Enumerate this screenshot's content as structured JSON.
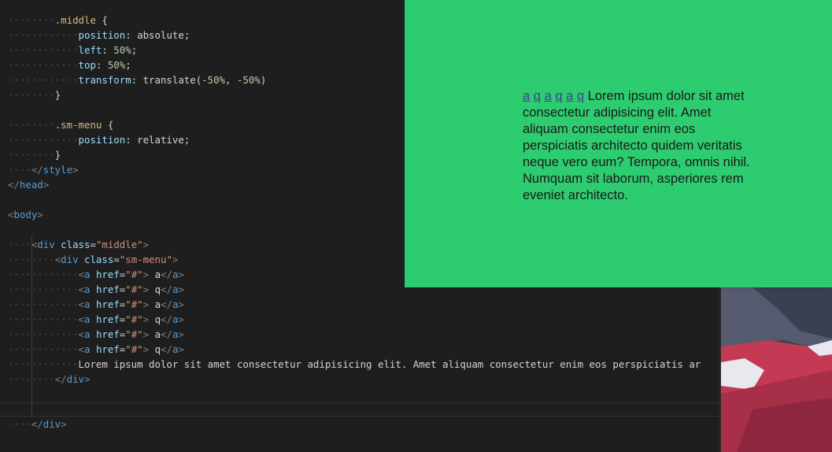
{
  "editor": {
    "lines": [
      {
        "ws": "········",
        "parts": [
          {
            "c": "sel",
            "t": ".middle"
          },
          {
            "c": "txt",
            "t": " {"
          }
        ]
      },
      {
        "ws": "············",
        "parts": [
          {
            "c": "prop",
            "t": "position"
          },
          {
            "c": "txt",
            "t": ": "
          },
          {
            "c": "txt",
            "t": "absolute;"
          }
        ]
      },
      {
        "ws": "············",
        "parts": [
          {
            "c": "prop",
            "t": "left"
          },
          {
            "c": "txt",
            "t": ": "
          },
          {
            "c": "num",
            "t": "50%"
          },
          {
            "c": "txt",
            "t": ";"
          }
        ]
      },
      {
        "ws": "············",
        "parts": [
          {
            "c": "prop",
            "t": "top"
          },
          {
            "c": "txt",
            "t": ": "
          },
          {
            "c": "num",
            "t": "50%"
          },
          {
            "c": "txt",
            "t": ";"
          }
        ]
      },
      {
        "ws": "············",
        "parts": [
          {
            "c": "prop",
            "t": "transform"
          },
          {
            "c": "txt",
            "t": ": translate("
          },
          {
            "c": "num",
            "t": "-50%"
          },
          {
            "c": "txt",
            "t": ", "
          },
          {
            "c": "num",
            "t": "-50%"
          },
          {
            "c": "txt",
            "t": ")"
          }
        ]
      },
      {
        "ws": "········",
        "parts": [
          {
            "c": "txt",
            "t": "}"
          }
        ]
      },
      {
        "ws": "",
        "parts": []
      },
      {
        "ws": "········",
        "parts": [
          {
            "c": "sel",
            "t": ".sm-menu"
          },
          {
            "c": "txt",
            "t": " {"
          }
        ]
      },
      {
        "ws": "············",
        "parts": [
          {
            "c": "prop",
            "t": "position"
          },
          {
            "c": "txt",
            "t": ": relative;"
          }
        ]
      },
      {
        "ws": "········",
        "parts": [
          {
            "c": "txt",
            "t": "}"
          }
        ]
      },
      {
        "ws": "····",
        "parts": [
          {
            "c": "brk",
            "t": "</"
          },
          {
            "c": "tag",
            "t": "style"
          },
          {
            "c": "brk",
            "t": ">"
          }
        ]
      },
      {
        "ws": "",
        "parts": [
          {
            "c": "brk",
            "t": "</"
          },
          {
            "c": "tag",
            "t": "head"
          },
          {
            "c": "brk",
            "t": ">"
          }
        ]
      },
      {
        "ws": "",
        "parts": []
      },
      {
        "ws": "",
        "parts": [
          {
            "c": "brk",
            "t": "<"
          },
          {
            "c": "tag",
            "t": "body"
          },
          {
            "c": "brk",
            "t": ">"
          }
        ]
      },
      {
        "ws": "",
        "parts": []
      },
      {
        "ws": "····",
        "parts": [
          {
            "c": "brk",
            "t": "<"
          },
          {
            "c": "tag",
            "t": "div"
          },
          {
            "c": "txt",
            "t": " "
          },
          {
            "c": "attr",
            "t": "class"
          },
          {
            "c": "txt",
            "t": "="
          },
          {
            "c": "str",
            "t": "\"middle\""
          },
          {
            "c": "brk",
            "t": ">"
          }
        ]
      },
      {
        "ws": "········",
        "parts": [
          {
            "c": "brk",
            "t": "<"
          },
          {
            "c": "tag",
            "t": "div"
          },
          {
            "c": "txt",
            "t": " "
          },
          {
            "c": "attr",
            "t": "class"
          },
          {
            "c": "txt",
            "t": "="
          },
          {
            "c": "str",
            "t": "\"sm-menu\""
          },
          {
            "c": "brk",
            "t": ">"
          }
        ]
      },
      {
        "ws": "············",
        "parts": [
          {
            "c": "brk",
            "t": "<"
          },
          {
            "c": "tag",
            "t": "a"
          },
          {
            "c": "txt",
            "t": " "
          },
          {
            "c": "attr",
            "t": "href"
          },
          {
            "c": "txt",
            "t": "="
          },
          {
            "c": "str",
            "t": "\"#\""
          },
          {
            "c": "brk",
            "t": ">"
          },
          {
            "c": "txt",
            "t": " a"
          },
          {
            "c": "brk",
            "t": "</"
          },
          {
            "c": "tag",
            "t": "a"
          },
          {
            "c": "brk",
            "t": ">"
          }
        ]
      },
      {
        "ws": "············",
        "parts": [
          {
            "c": "brk",
            "t": "<"
          },
          {
            "c": "tag",
            "t": "a"
          },
          {
            "c": "txt",
            "t": " "
          },
          {
            "c": "attr",
            "t": "href"
          },
          {
            "c": "txt",
            "t": "="
          },
          {
            "c": "str",
            "t": "\"#\""
          },
          {
            "c": "brk",
            "t": ">"
          },
          {
            "c": "txt",
            "t": " q"
          },
          {
            "c": "brk",
            "t": "</"
          },
          {
            "c": "tag",
            "t": "a"
          },
          {
            "c": "brk",
            "t": ">"
          }
        ]
      },
      {
        "ws": "············",
        "parts": [
          {
            "c": "brk",
            "t": "<"
          },
          {
            "c": "tag",
            "t": "a"
          },
          {
            "c": "txt",
            "t": " "
          },
          {
            "c": "attr",
            "t": "href"
          },
          {
            "c": "txt",
            "t": "="
          },
          {
            "c": "str",
            "t": "\"#\""
          },
          {
            "c": "brk",
            "t": ">"
          },
          {
            "c": "txt",
            "t": " a"
          },
          {
            "c": "brk",
            "t": "</"
          },
          {
            "c": "tag",
            "t": "a"
          },
          {
            "c": "brk",
            "t": ">"
          }
        ]
      },
      {
        "ws": "············",
        "parts": [
          {
            "c": "brk",
            "t": "<"
          },
          {
            "c": "tag",
            "t": "a"
          },
          {
            "c": "txt",
            "t": " "
          },
          {
            "c": "attr",
            "t": "href"
          },
          {
            "c": "txt",
            "t": "="
          },
          {
            "c": "str",
            "t": "\"#\""
          },
          {
            "c": "brk",
            "t": ">"
          },
          {
            "c": "txt",
            "t": " q"
          },
          {
            "c": "brk",
            "t": "</"
          },
          {
            "c": "tag",
            "t": "a"
          },
          {
            "c": "brk",
            "t": ">"
          }
        ]
      },
      {
        "ws": "············",
        "parts": [
          {
            "c": "brk",
            "t": "<"
          },
          {
            "c": "tag",
            "t": "a"
          },
          {
            "c": "txt",
            "t": " "
          },
          {
            "c": "attr",
            "t": "href"
          },
          {
            "c": "txt",
            "t": "="
          },
          {
            "c": "str",
            "t": "\"#\""
          },
          {
            "c": "brk",
            "t": ">"
          },
          {
            "c": "txt",
            "t": " a"
          },
          {
            "c": "brk",
            "t": "</"
          },
          {
            "c": "tag",
            "t": "a"
          },
          {
            "c": "brk",
            "t": ">"
          }
        ]
      },
      {
        "ws": "············",
        "parts": [
          {
            "c": "brk",
            "t": "<"
          },
          {
            "c": "tag",
            "t": "a"
          },
          {
            "c": "txt",
            "t": " "
          },
          {
            "c": "attr",
            "t": "href"
          },
          {
            "c": "txt",
            "t": "="
          },
          {
            "c": "str",
            "t": "\"#\""
          },
          {
            "c": "brk",
            "t": ">"
          },
          {
            "c": "txt",
            "t": " q"
          },
          {
            "c": "brk",
            "t": "</"
          },
          {
            "c": "tag",
            "t": "a"
          },
          {
            "c": "brk",
            "t": ">"
          }
        ]
      },
      {
        "ws": "············",
        "parts": [
          {
            "c": "txt",
            "t": "Lorem ipsum dolor sit amet consectetur adipisicing elit. Amet aliquam consectetur enim eos perspiciatis ar"
          }
        ]
      },
      {
        "ws": "········",
        "parts": [
          {
            "c": "brk",
            "t": "</"
          },
          {
            "c": "tag",
            "t": "div"
          },
          {
            "c": "brk",
            "t": ">"
          }
        ]
      },
      {
        "ws": "",
        "parts": []
      },
      {
        "ws": "",
        "parts": []
      },
      {
        "ws": "····",
        "parts": [
          {
            "c": "brk",
            "t": "</"
          },
          {
            "c": "tag",
            "t": "div"
          },
          {
            "c": "brk",
            "t": ">"
          }
        ]
      }
    ]
  },
  "preview": {
    "background": "#2ecc71",
    "links": [
      "a",
      "q",
      "a",
      "q",
      "a",
      "q"
    ],
    "text": "Lorem ipsum dolor sit amet consectetur adipisicing elit. Amet aliquam consectetur enim eos perspiciatis architecto quidem veritatis neque vero eum? Tempora, omnis nihil. Numquam sit laborum, asperiores rem eveniet architecto."
  }
}
